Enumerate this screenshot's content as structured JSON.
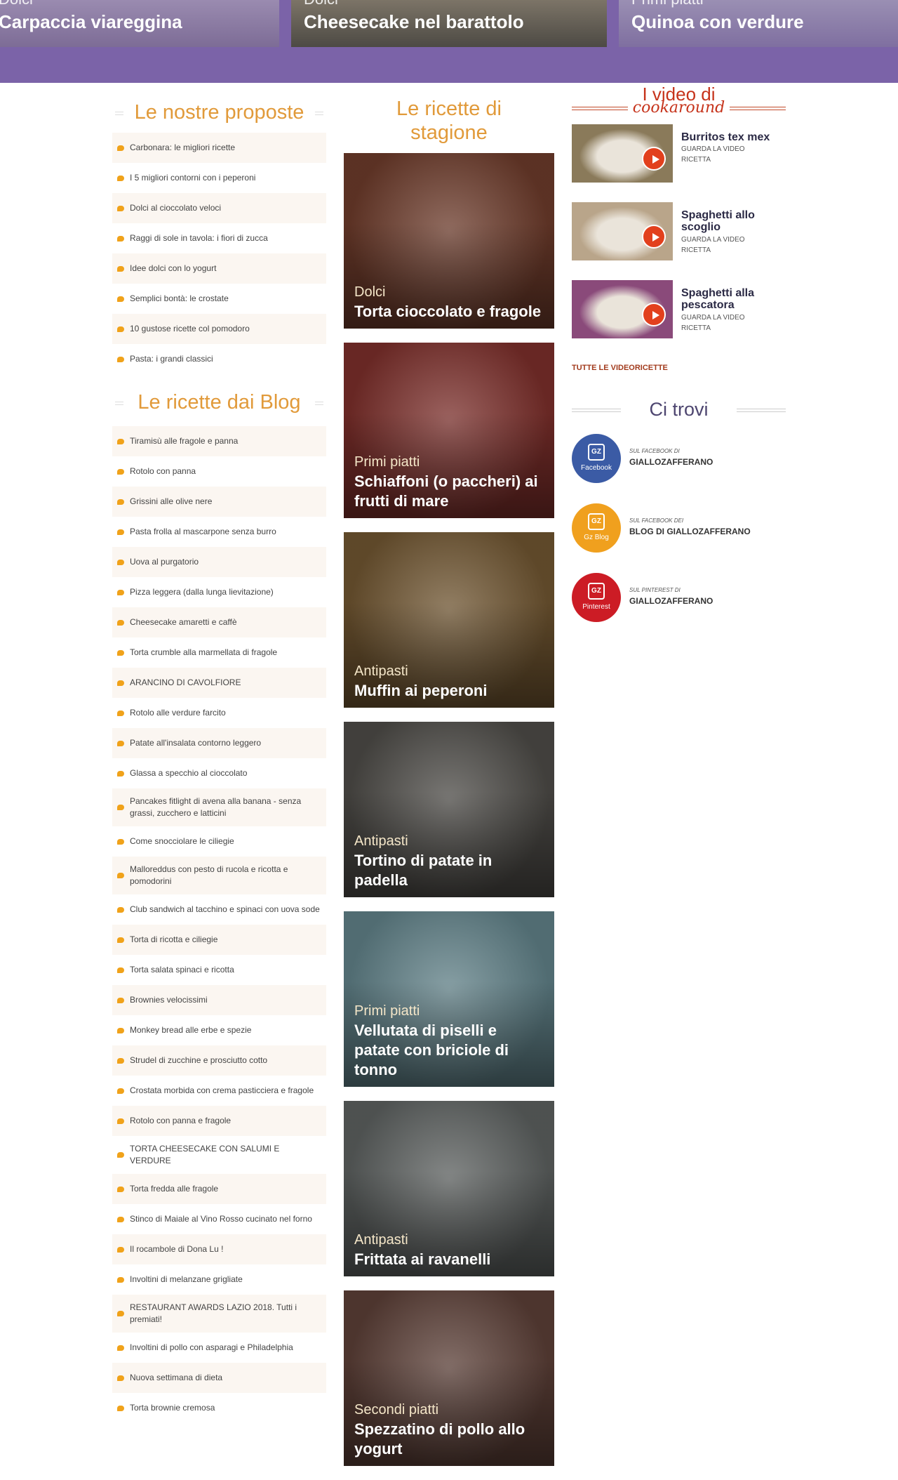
{
  "top_carousel": [
    {
      "category": "Dolci",
      "title": "Carpaccia viareggina"
    },
    {
      "category": "Dolci",
      "title": "Cheesecake nel barattolo"
    },
    {
      "category": "Primi piatti",
      "title": "Quinoa con verdure"
    }
  ],
  "left": {
    "proposte_title": "Le nostre proposte",
    "proposte": [
      "Carbonara: le migliori ricette",
      "I 5 migliori contorni con i peperoni",
      "Dolci al cioccolato veloci",
      "Raggi di sole in tavola: i fiori di zucca",
      "Idee dolci con lo yogurt",
      "Semplici bontà: le crostate",
      "10 gustose ricette col pomodoro",
      "Pasta: i grandi classici"
    ],
    "blog_title": "Le ricette dai Blog",
    "blog": [
      "Tiramisù alle fragole e panna",
      "Rotolo con panna",
      "Grissini alle olive nere",
      "Pasta frolla al mascarpone senza burro",
      "Uova al purgatorio",
      "Pizza leggera (dalla lunga lievitazione)",
      "Cheesecake amaretti e caffè",
      "Torta crumble alla marmellata di fragole",
      "ARANCINO DI CAVOLFIORE",
      "Rotolo alle verdure farcito",
      "Patate all'insalata contorno leggero",
      "Glassa a specchio al cioccolato",
      "Pancakes fitlight di avena alla banana - senza grassi, zucchero e latticini",
      "Come snocciolare le ciliegie",
      "Malloreddus con pesto di rucola e ricotta e pomodorini",
      "Club sandwich al tacchino e spinaci con uova sode",
      "Torta di ricotta e ciliegie",
      "Torta salata spinaci e ricotta",
      "Brownies velocissimi",
      "Monkey bread alle erbe e spezie",
      "Strudel di zucchine e prosciutto cotto",
      "Crostata morbida con crema pasticciera e fragole",
      "Rotolo con panna e fragole",
      "TORTA CHEESECAKE CON SALUMI E VERDURE",
      "Torta fredda alle fragole",
      "Stinco di Maiale al Vino Rosso cucinato nel forno",
      "Il rocambole di Dona Lu !",
      "Involtini di melanzane grigliate",
      "RESTAURANT AWARDS LAZIO 2018. Tutti i premiati!",
      "Involtini di pollo con asparagi e Philadelphia",
      "Nuova settimana di dieta",
      "Torta brownie cremosa"
    ]
  },
  "center": {
    "title": "Le ricette di stagione",
    "cards": [
      {
        "category": "Dolci",
        "title": "Torta cioccolato e fragole",
        "img_color": "#6b3a2a"
      },
      {
        "category": "Primi piatti",
        "title": "Schiaffoni (o paccheri) ai frutti di mare",
        "img_color": "#7a2e2a"
      },
      {
        "category": "Antipasti",
        "title": "Muffin ai peperoni",
        "img_color": "#6e5430"
      },
      {
        "category": "Antipasti",
        "title": "Tortino di patate in padella",
        "img_color": "#4c4a46"
      },
      {
        "category": "Primi piatti",
        "title": "Vellutata di piselli e patate con briciole di tonno",
        "img_color": "#5f7f86"
      },
      {
        "category": "Antipasti",
        "title": "Frittata ai ravanelli",
        "img_color": "#5b5f5e"
      },
      {
        "category": "Secondi piatti",
        "title": "Spezzatino di pollo allo yogurt",
        "img_color": "#5a3e36"
      }
    ]
  },
  "right": {
    "video_heading_line1": "I video di",
    "video_heading_line2": "cookaround",
    "videos": [
      {
        "title": "Burritos tex mex",
        "sub": "GUARDA LA VIDEO RICETTA",
        "thumb_color": "#8a7a5a"
      },
      {
        "title": "Spaghetti allo scoglio",
        "sub": "GUARDA LA VIDEO RICETTA",
        "thumb_color": "#b9a58a"
      },
      {
        "title": "Spaghetti alla pescatora",
        "sub": "GUARDA LA VIDEO RICETTA",
        "thumb_color": "#8a4a7a"
      }
    ],
    "all_videos": "TUTTE LE VIDEORICETTE",
    "ci_trovi": "Ci trovi",
    "social": [
      {
        "small": "SUL FACEBOOK DI",
        "big": "GIALLOZAFFERANO",
        "badge": "Facebook",
        "color": "#3b5ba5"
      },
      {
        "small": "SUL FACEBOOK DEI",
        "big": "BLOG DI GIALLOZAFFERANO",
        "badge": "Gz Blog",
        "color": "#f0a01e"
      },
      {
        "small": "SUL PINTEREST DI",
        "big": "GIALLOZAFFERANO",
        "badge": "Pinterest",
        "color": "#cc1c25"
      }
    ]
  },
  "colors": {
    "band": "#7b63a8",
    "accent_orange": "#e19a3a",
    "accent_red": "#c6331b"
  }
}
